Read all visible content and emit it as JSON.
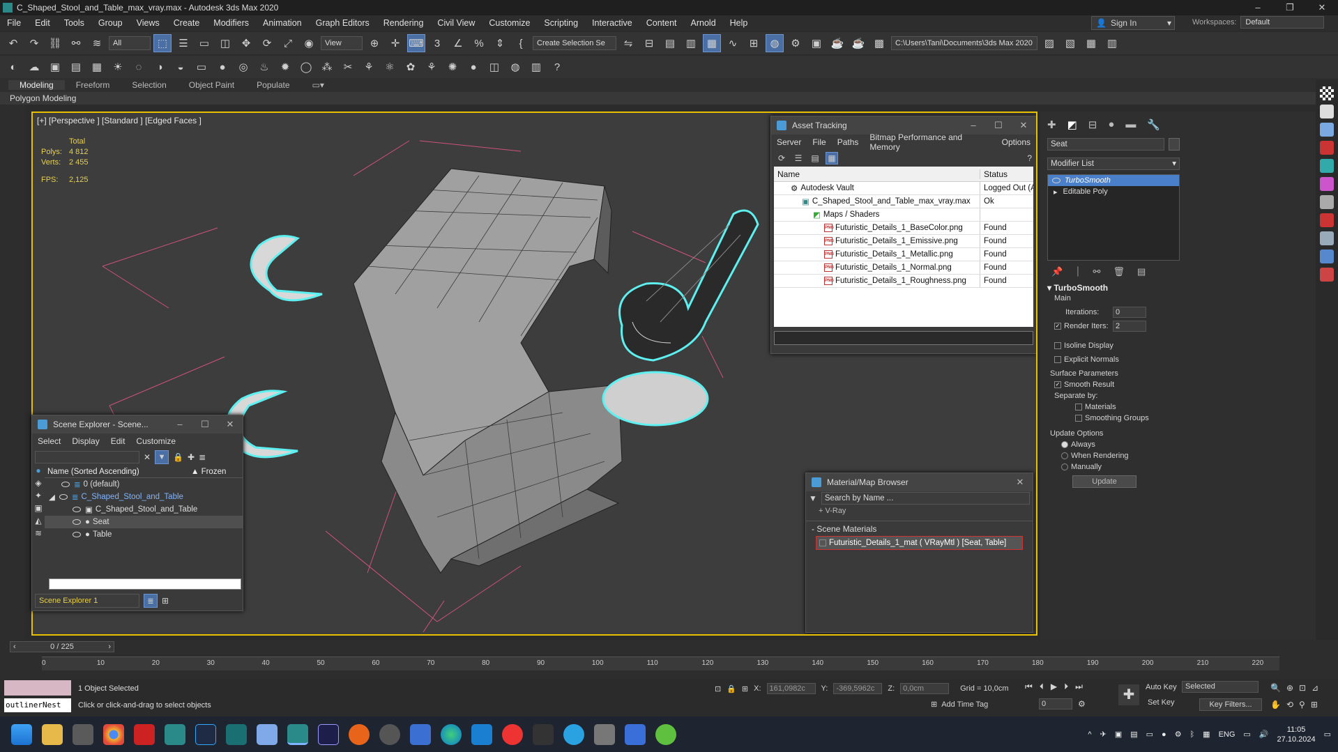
{
  "title": "C_Shaped_Stool_and_Table_max_vray.max - Autodesk 3ds Max 2020",
  "menu": [
    "File",
    "Edit",
    "Tools",
    "Group",
    "Views",
    "Create",
    "Modifiers",
    "Animation",
    "Graph Editors",
    "Rendering",
    "Civil View",
    "Customize",
    "Scripting",
    "Interactive",
    "Content",
    "Arnold",
    "Help"
  ],
  "signin": "Sign In",
  "workspaces_label": "Workspaces:",
  "workspace": "Default",
  "toolbar": {
    "filter": "All",
    "view": "View",
    "selection_set": "Create Selection Se",
    "path": "C:\\Users\\Tani\\Documents\\3ds Max 2020"
  },
  "ribbon": {
    "tabs": [
      "Modeling",
      "Freeform",
      "Selection",
      "Object Paint",
      "Populate"
    ],
    "sub": "Polygon Modeling"
  },
  "viewport": {
    "label": "[+] [Perspective ] [Standard ] [Edged Faces ]",
    "total": "Total",
    "polys_label": "Polys:",
    "polys": "4 812",
    "verts_label": "Verts:",
    "verts": "2 455",
    "fps_label": "FPS:",
    "fps": "2,125"
  },
  "asset": {
    "title": "Asset Tracking",
    "menu": [
      "Server",
      "File",
      "Paths",
      "Bitmap Performance and Memory",
      "Options"
    ],
    "col_name": "Name",
    "col_status": "Status",
    "rows": [
      {
        "name": "Autodesk Vault",
        "status": "Logged Out (A"
      },
      {
        "name": "C_Shaped_Stool_and_Table_max_vray.max",
        "status": "Ok"
      },
      {
        "name": "Maps / Shaders",
        "status": ""
      },
      {
        "name": "Futuristic_Details_1_BaseColor.png",
        "status": "Found"
      },
      {
        "name": "Futuristic_Details_1_Emissive.png",
        "status": "Found"
      },
      {
        "name": "Futuristic_Details_1_Metallic.png",
        "status": "Found"
      },
      {
        "name": "Futuristic_Details_1_Normal.png",
        "status": "Found"
      },
      {
        "name": "Futuristic_Details_1_Roughness.png",
        "status": "Found"
      }
    ]
  },
  "scene": {
    "title": "Scene Explorer - Scene...",
    "menu": [
      "Select",
      "Display",
      "Edit",
      "Customize"
    ],
    "col_name": "Name (Sorted Ascending)",
    "col_frozen": "▲ Frozen",
    "rows": [
      "0 (default)",
      "C_Shaped_Stool_and_Table",
      "C_Shaped_Stool_and_Table",
      "Seat",
      "Table"
    ],
    "footer": "Scene Explorer 1"
  },
  "matbr": {
    "title": "Material/Map Browser",
    "search": "Search by Name ...",
    "vray": "+ V-Ray",
    "section": "- Scene Materials",
    "material": "Futuristic_Details_1_mat  ( VRayMtl ) [Seat, Table]"
  },
  "cmd": {
    "object": "Seat",
    "modlist": "Modifier List",
    "stack": [
      "TurboSmooth",
      "Editable Poly"
    ],
    "ts_title": "TurboSmooth",
    "main": "Main",
    "iter_label": "Iterations:",
    "iter": "0",
    "riter_label": "Render Iters:",
    "riter": "2",
    "isoline": "Isoline Display",
    "explicit": "Explicit Normals",
    "surf": "Surface Parameters",
    "smooth": "Smooth Result",
    "sepby": "Separate by:",
    "materials": "Materials",
    "smgroups": "Smoothing Groups",
    "update_opts": "Update Options",
    "always": "Always",
    "when_render": "When Rendering",
    "manually": "Manually",
    "update": "Update"
  },
  "timeline": {
    "frame": "0 / 225",
    "ticks": [
      "0",
      "10",
      "20",
      "30",
      "40",
      "50",
      "60",
      "70",
      "80",
      "90",
      "100",
      "110",
      "120",
      "130",
      "140",
      "150",
      "160",
      "170",
      "180",
      "190",
      "200",
      "210",
      "220"
    ]
  },
  "status": {
    "selected": "1 Object Selected",
    "hint": "Click or click-and-drag to select objects",
    "script": "outlinerNest",
    "x_label": "X:",
    "x": "161,0982c",
    "y_label": "Y:",
    "y": "-369,5962c",
    "z_label": "Z:",
    "z": "0,0cm",
    "grid": "Grid = 10,0cm",
    "addtime": "Add Time Tag",
    "autokey": "Auto Key",
    "setkey": "Set Key",
    "selected_dd": "Selected",
    "keyfilters": "Key Filters...",
    "frame_num": "0"
  },
  "taskbar": {
    "lang": "ENG",
    "time": "11:05",
    "date": "27.10.2024"
  }
}
